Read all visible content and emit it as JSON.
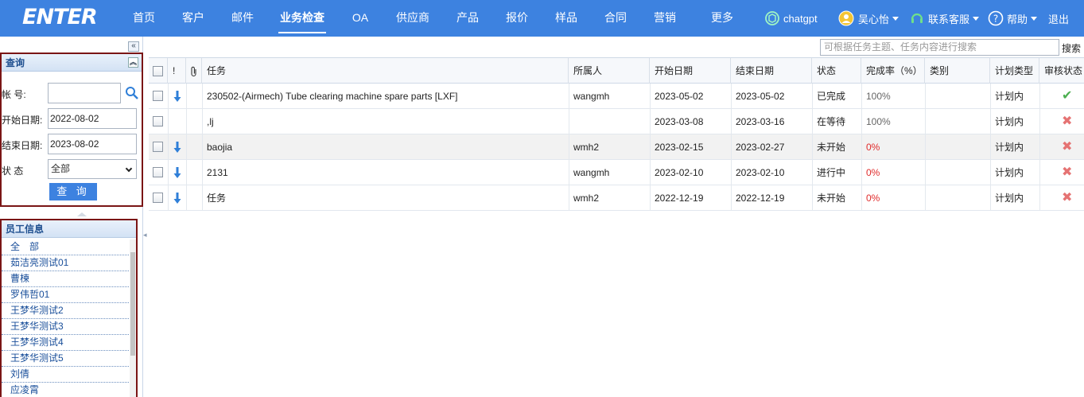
{
  "app": {
    "logo": "ENTER"
  },
  "nav": {
    "items": [
      {
        "label": "首页",
        "active": false
      },
      {
        "label": "客户",
        "active": false
      },
      {
        "label": "邮件",
        "active": false
      },
      {
        "label": "业务检查",
        "active": true
      },
      {
        "label": "OA",
        "active": false
      },
      {
        "label": "供应商",
        "active": false
      },
      {
        "label": "产品",
        "active": false
      },
      {
        "label": "报价",
        "active": false
      },
      {
        "label": "样品",
        "active": false
      },
      {
        "label": "合同",
        "active": false
      },
      {
        "label": "营销",
        "active": false
      },
      {
        "label": "更多",
        "active": false
      }
    ],
    "chatgpt": "chatgpt",
    "user": "吴心怡",
    "support": "联系客服",
    "help": "帮助",
    "logout": "退出"
  },
  "query": {
    "title": "查询",
    "account_label": "帐 号:",
    "account_value": "",
    "start_label": "开始日期:",
    "start_value": "2022-08-02",
    "end_label": "结束日期:",
    "end_value": "2023-08-02",
    "status_label": "状 态",
    "status_value": "全部",
    "submit": "查 询"
  },
  "employees": {
    "title": "员工信息",
    "items": [
      "全　部",
      "茹洁亮测试01",
      "曹楝",
      "罗伟哲01",
      "王梦华测试2",
      "王梦华测试3",
      "王梦华测试4",
      "王梦华测试5",
      "刘倩",
      "应凌霄"
    ]
  },
  "search": {
    "placeholder": "可根据任务主题、任务内容进行搜索",
    "button": "搜索"
  },
  "table": {
    "headers": {
      "flag": "!",
      "task": "任务",
      "owner": "所属人",
      "start": "开始日期",
      "end": "结束日期",
      "status": "状态",
      "rate": "完成率（%）",
      "category": "类别",
      "plan": "计划类型",
      "review": "审核状态"
    },
    "rows": [
      {
        "arrow": true,
        "task": "230502-(Airmech) Tube clearing machine spare parts [LXF]",
        "owner": "wangmh",
        "start": "2023-05-02",
        "end": "2023-05-02",
        "status": "已完成",
        "rate": "100%",
        "rate_color": "gray",
        "category": "",
        "plan": "计划内",
        "review": "approved",
        "highlight": false
      },
      {
        "arrow": false,
        "task": ",lj",
        "owner": "",
        "start": "2023-03-08",
        "end": "2023-03-16",
        "status": "在等待",
        "rate": "100%",
        "rate_color": "gray",
        "category": "",
        "plan": "计划内",
        "review": "rejected",
        "highlight": false
      },
      {
        "arrow": true,
        "task": "baojia",
        "owner": "wmh2",
        "start": "2023-02-15",
        "end": "2023-02-27",
        "status": "未开始",
        "rate": "0%",
        "rate_color": "red",
        "category": "",
        "plan": "计划内",
        "review": "rejected",
        "highlight": true
      },
      {
        "arrow": true,
        "task": "2131",
        "owner": "wangmh",
        "start": "2023-02-10",
        "end": "2023-02-10",
        "status": "进行中",
        "rate": "0%",
        "rate_color": "red",
        "category": "",
        "plan": "计划内",
        "review": "rejected",
        "highlight": false
      },
      {
        "arrow": true,
        "task": "任务",
        "owner": "wmh2",
        "start": "2022-12-19",
        "end": "2022-12-19",
        "status": "未开始",
        "rate": "0%",
        "rate_color": "red",
        "category": "",
        "plan": "计划内",
        "review": "rejected",
        "highlight": false
      }
    ]
  },
  "colors": {
    "primary": "#3d82e0",
    "highlight_border": "#7a1515",
    "link": "#1a4f9a",
    "approved": "#4caf50",
    "rejected": "#e57373"
  }
}
